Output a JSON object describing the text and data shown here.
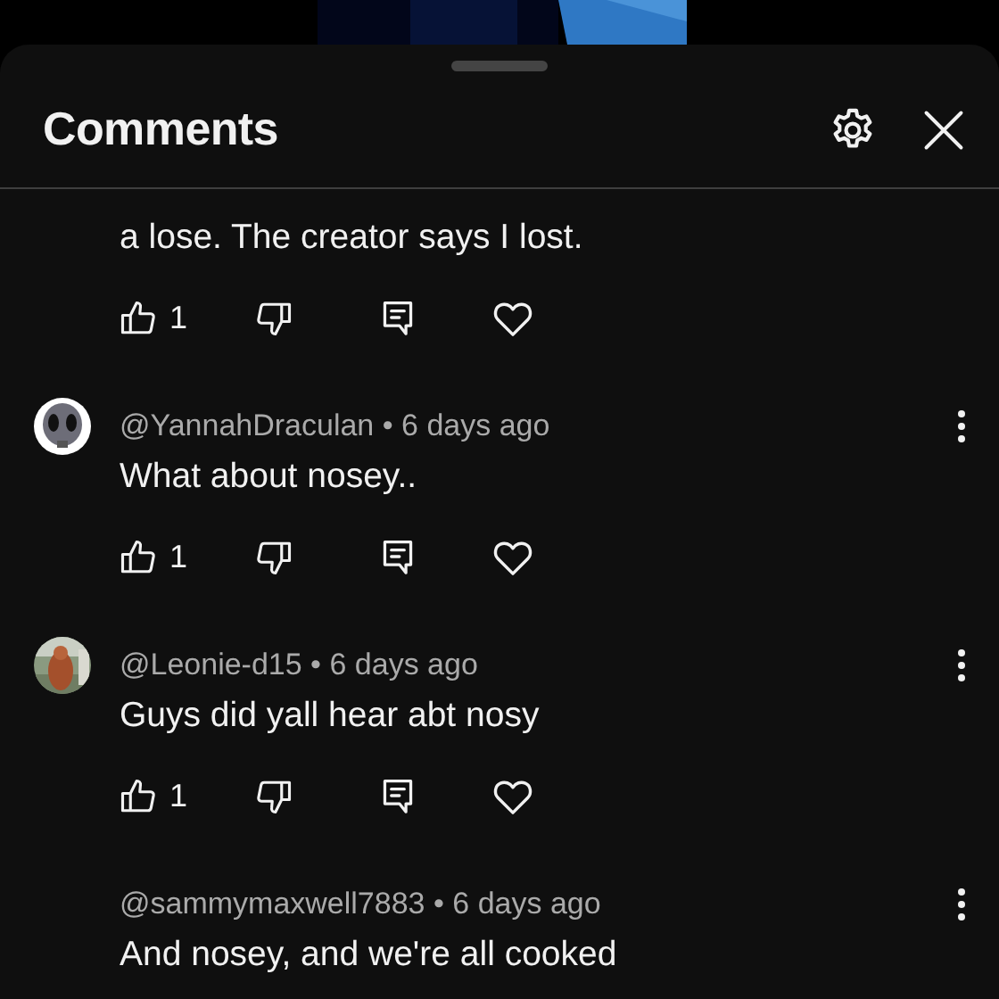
{
  "sheet": {
    "title": "Comments"
  },
  "comments": [
    {
      "text": "a lose. The creator says I lost.",
      "likes": "1"
    },
    {
      "avatar": {
        "kind": "figure"
      },
      "byline": "@YannahDraculan • 6 days ago",
      "text": "What about nosey..",
      "likes": "1"
    },
    {
      "byline": "@Leonie-d15 • 6 days ago",
      "text": "Guys did yall hear abt nosy",
      "likes": "1"
    },
    {
      "byline": "@sammymaxwell7883 • 6 days ago",
      "text": "And nosey, and we're all cooked"
    }
  ]
}
